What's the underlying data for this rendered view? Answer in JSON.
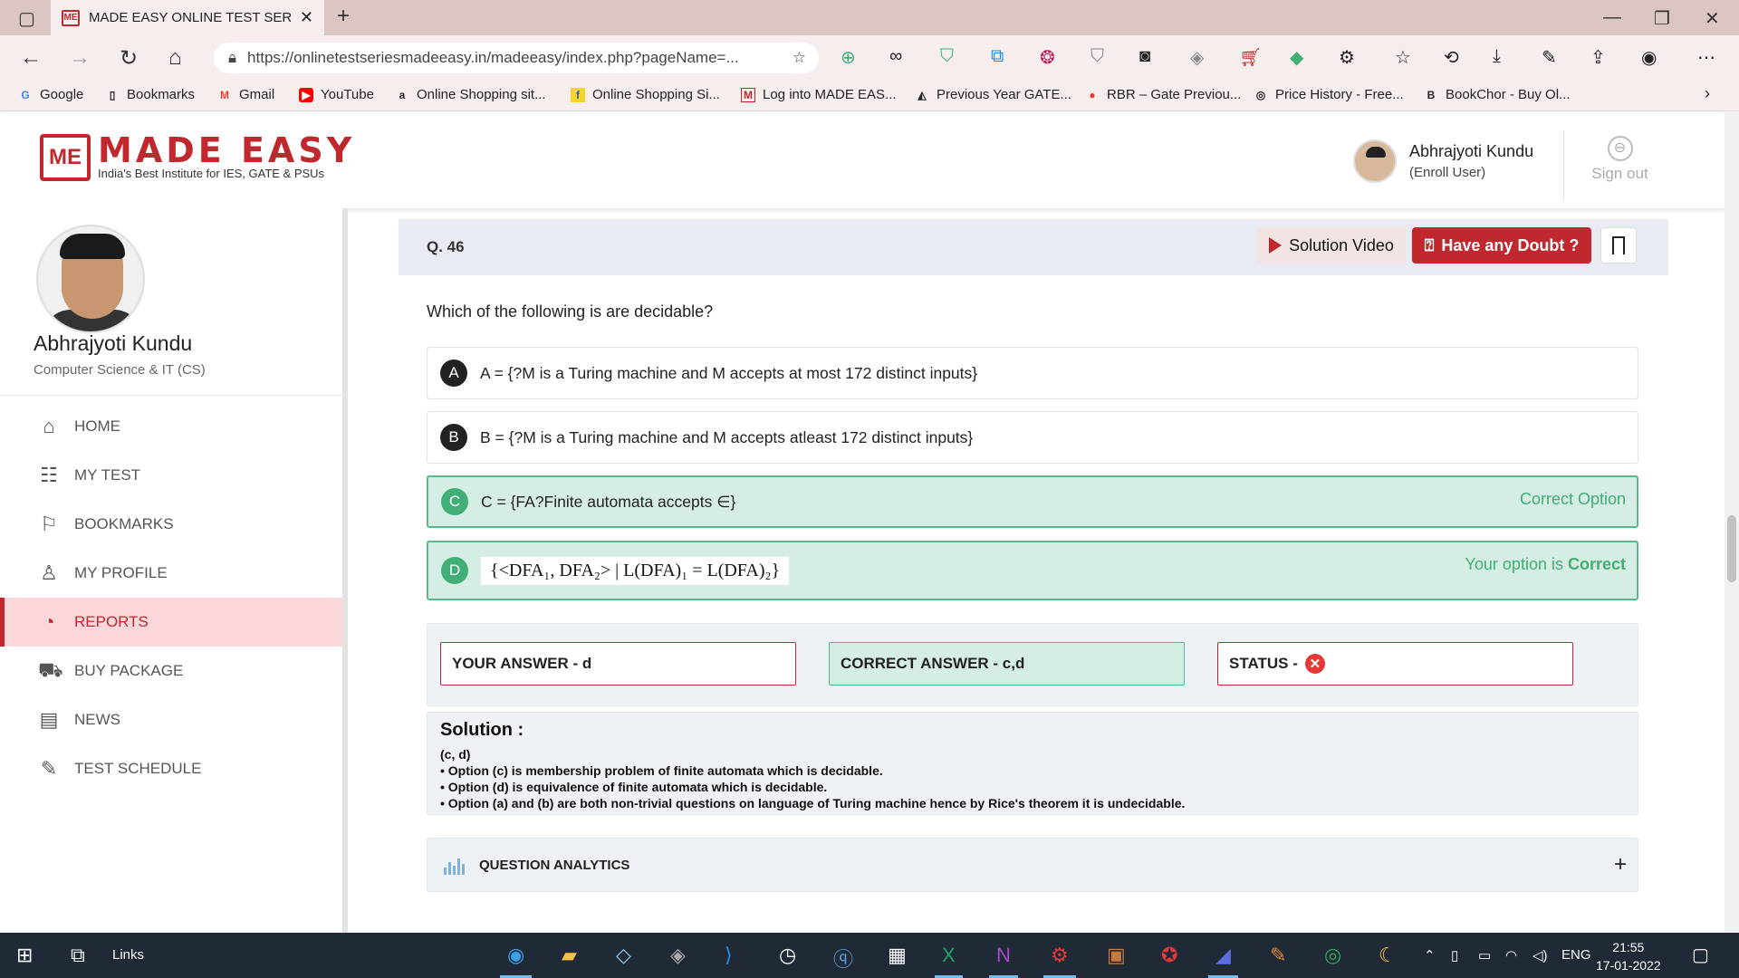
{
  "browser": {
    "tab_title": "MADE EASY ONLINE TEST SERIES",
    "url": "https://onlinetestseriesmadeeasy.in/madeeasy/index.php?pageName=...",
    "bookmarks": [
      {
        "label": "Google",
        "icon": "google-icon"
      },
      {
        "label": "Bookmarks",
        "icon": "page-icon"
      },
      {
        "label": "Gmail",
        "icon": "gmail-icon"
      },
      {
        "label": "YouTube",
        "icon": "youtube-icon"
      },
      {
        "label": "Online Shopping sit...",
        "icon": "amazon-icon"
      },
      {
        "label": "Online Shopping Si...",
        "icon": "flipkart-icon"
      },
      {
        "label": "Log into MADE EAS...",
        "icon": "madeeasy-icon"
      },
      {
        "label": "Previous Year GATE...",
        "icon": "gate-icon"
      },
      {
        "label": "RBR – Gate Previou...",
        "icon": "rbr-icon"
      },
      {
        "label": "Price History - Free...",
        "icon": "price-icon"
      },
      {
        "label": "BookChor - Buy Ol...",
        "icon": "bookchor-icon"
      }
    ]
  },
  "header": {
    "brand": "MADE EASY",
    "brand_mark": "ME",
    "tagline": "India's Best Institute for IES, GATE & PSUs",
    "user_name": "Abhrajyoti Kundu",
    "user_role": "(Enroll User)",
    "signout_label": "Sign out"
  },
  "sidebar": {
    "name": "Abhrajyoti Kundu",
    "branch": "Computer Science & IT (CS)",
    "items": [
      {
        "label": "HOME",
        "icon": "home-icon",
        "active": false
      },
      {
        "label": "MY TEST",
        "icon": "test-icon",
        "active": false
      },
      {
        "label": "BOOKMARKS",
        "icon": "bookmark-icon",
        "active": false
      },
      {
        "label": "MY PROFILE",
        "icon": "profile-icon",
        "active": false
      },
      {
        "label": "REPORTS",
        "icon": "reports-icon",
        "active": true
      },
      {
        "label": "BUY PACKAGE",
        "icon": "cart-icon",
        "active": false
      },
      {
        "label": "NEWS",
        "icon": "news-icon",
        "active": false
      },
      {
        "label": "TEST SCHEDULE",
        "icon": "schedule-icon",
        "active": false
      }
    ]
  },
  "question": {
    "number": "Q. 46",
    "solution_video": "Solution Video",
    "doubt": "Have any Doubt ?",
    "text": "Which of the following is are decidable?",
    "options": [
      {
        "letter": "A",
        "text": "A = {?M is a Turing machine and M accepts at most 172 distinct inputs}",
        "status": ""
      },
      {
        "letter": "B",
        "text": "B = {?M is a Turing machine and M accepts atleast 172 distinct inputs}",
        "status": ""
      },
      {
        "letter": "C",
        "text": "C = {FA?Finite automata accepts ∈}",
        "status": "Correct Option"
      },
      {
        "letter": "D",
        "text": "{<DFA₁, DFA₂> | L(DFA)₁ = L(DFA)₂}",
        "status_prefix": "Your option is ",
        "status_strong": "Correct"
      }
    ]
  },
  "answers": {
    "your": "YOUR ANSWER - d",
    "correct": "CORRECT ANSWER - c,d",
    "status": "STATUS -",
    "status_value": "incorrect"
  },
  "solution": {
    "heading": "Solution :",
    "lines": [
      "(c, d)",
      "• Option (c) is membership problem of finite automata which is decidable.",
      "• Option (d) is equivalence of finite automata which is decidable.",
      "• Option (a) and (b) are both non-trivial questions on language of Turing machine hence by Rice's theorem it is undecidable."
    ]
  },
  "analytics": {
    "label": "QUESTION ANALYTICS"
  },
  "taskbar": {
    "links_label": "Links",
    "lang": "ENG",
    "time": "21:55",
    "date": "17-01-2022"
  },
  "colors": {
    "brand": "#c0282d",
    "correct": "#3fae77",
    "active_bg": "#f9d7da"
  }
}
